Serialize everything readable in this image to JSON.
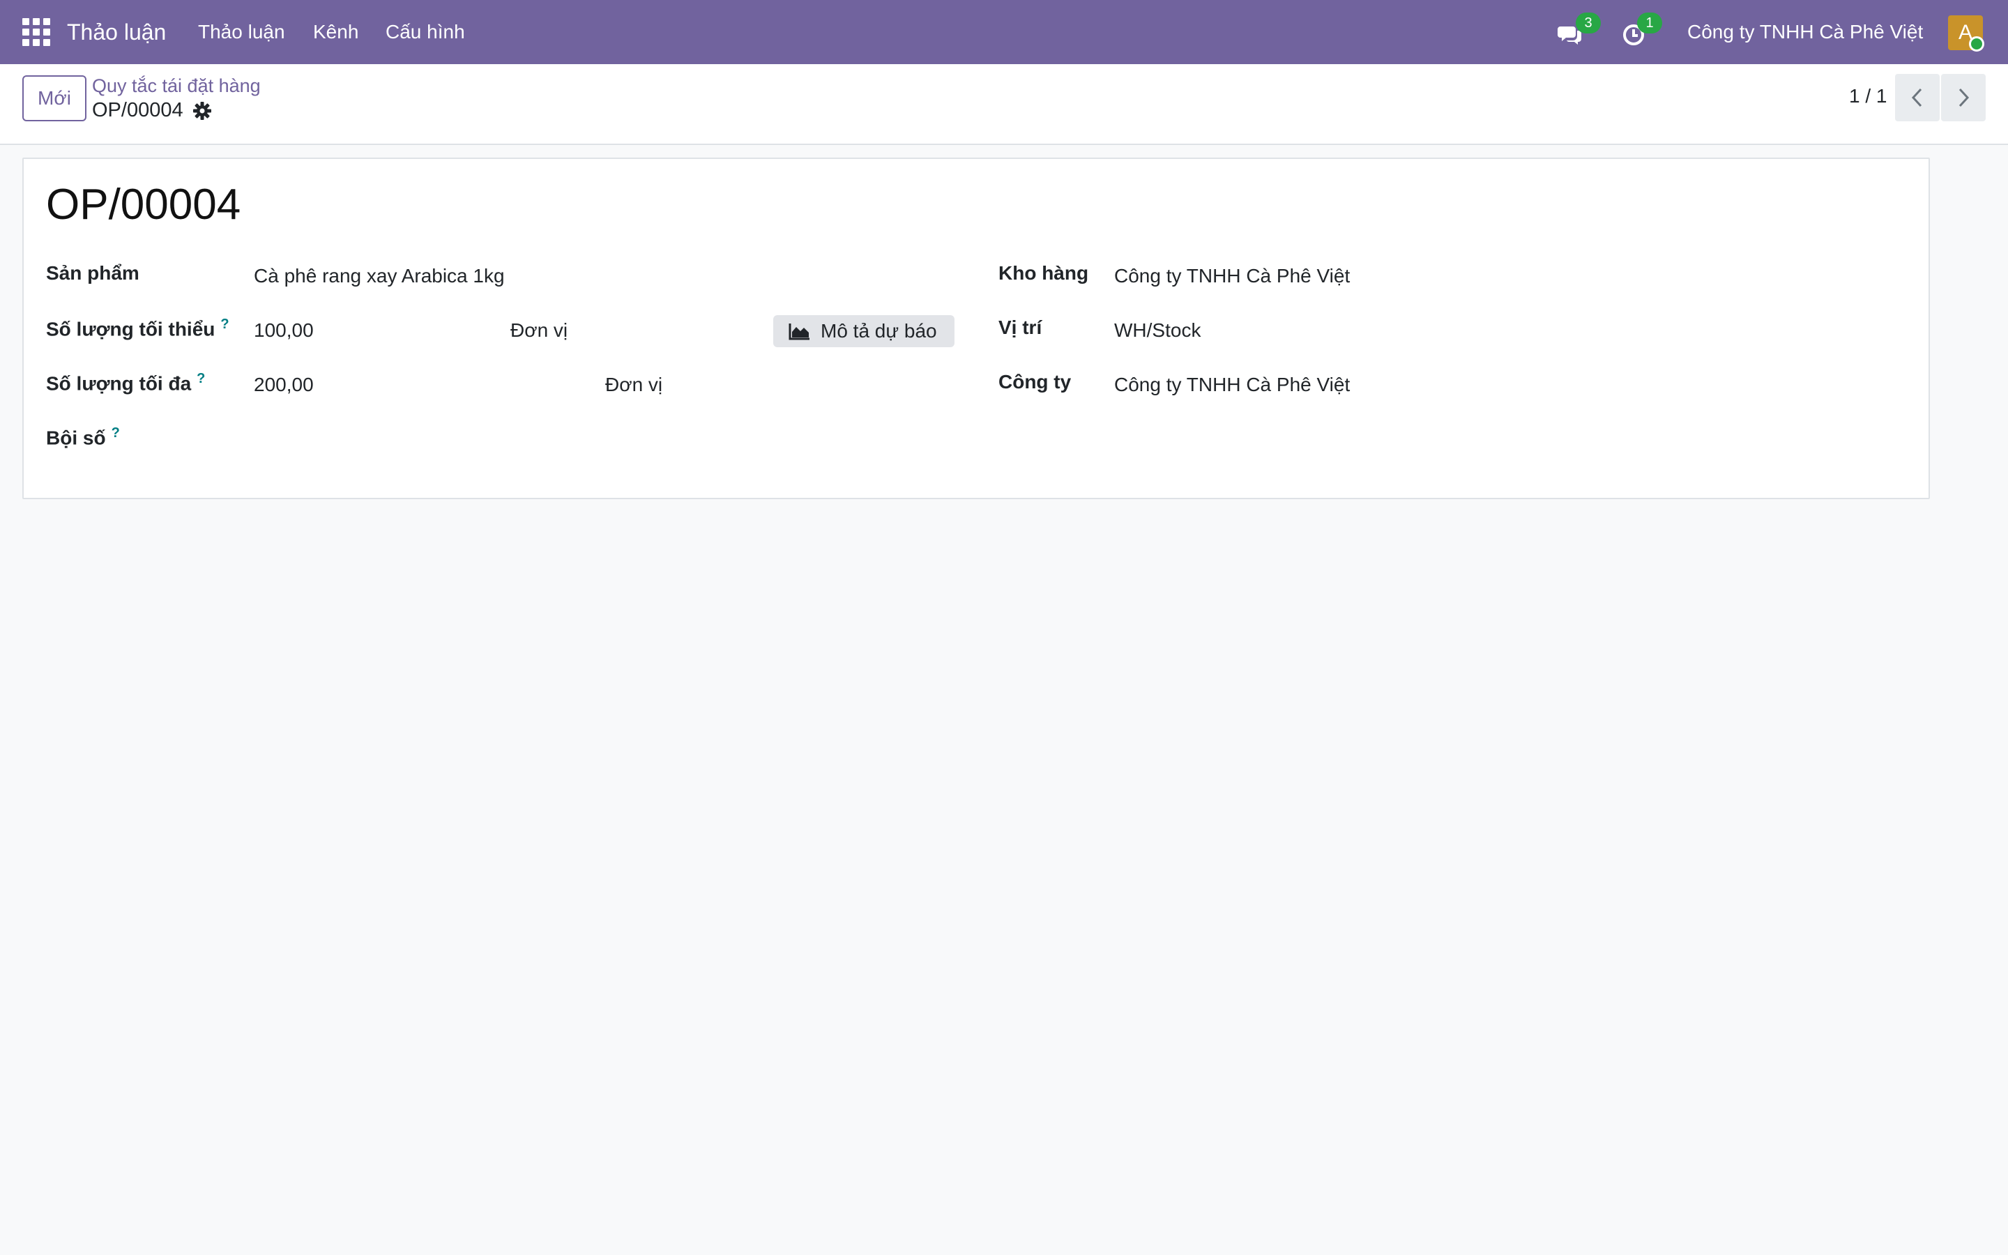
{
  "navbar": {
    "app_name": "Thảo luận",
    "menu": [
      "Thảo luận",
      "Kênh",
      "Cấu hình"
    ],
    "messages_count": "3",
    "activities_count": "1",
    "company": "Công ty TNHH Cà Phê Việt",
    "avatar_initial": "A",
    "accent_color": "#71639e"
  },
  "control_panel": {
    "new_label": "Mới",
    "breadcrumb_parent": "Quy tắc tái đặt hàng",
    "breadcrumb_current": "OP/00004",
    "pager": "1 / 1"
  },
  "form": {
    "title": "OP/00004",
    "product": {
      "label": "Sản phẩm",
      "value": "Cà phê rang xay Arabica 1kg"
    },
    "min_qty": {
      "label": "Số lượng tối thiểu",
      "help": "?",
      "value": "100,00",
      "uom": "Đơn vị"
    },
    "max_qty": {
      "label": "Số lượng tối đa",
      "help": "?",
      "value": "200,00",
      "uom": "Đơn vị"
    },
    "multiple": {
      "label": "Bội số",
      "help": "?",
      "value": ""
    },
    "forecast_button": "Mô tả dự báo",
    "warehouse": {
      "label": "Kho hàng",
      "value": "Công ty TNHH Cà Phê Việt"
    },
    "location": {
      "label": "Vị trí",
      "value": "WH/Stock"
    },
    "company": {
      "label": "Công ty",
      "value": "Công ty TNHH Cà Phê Việt"
    }
  }
}
